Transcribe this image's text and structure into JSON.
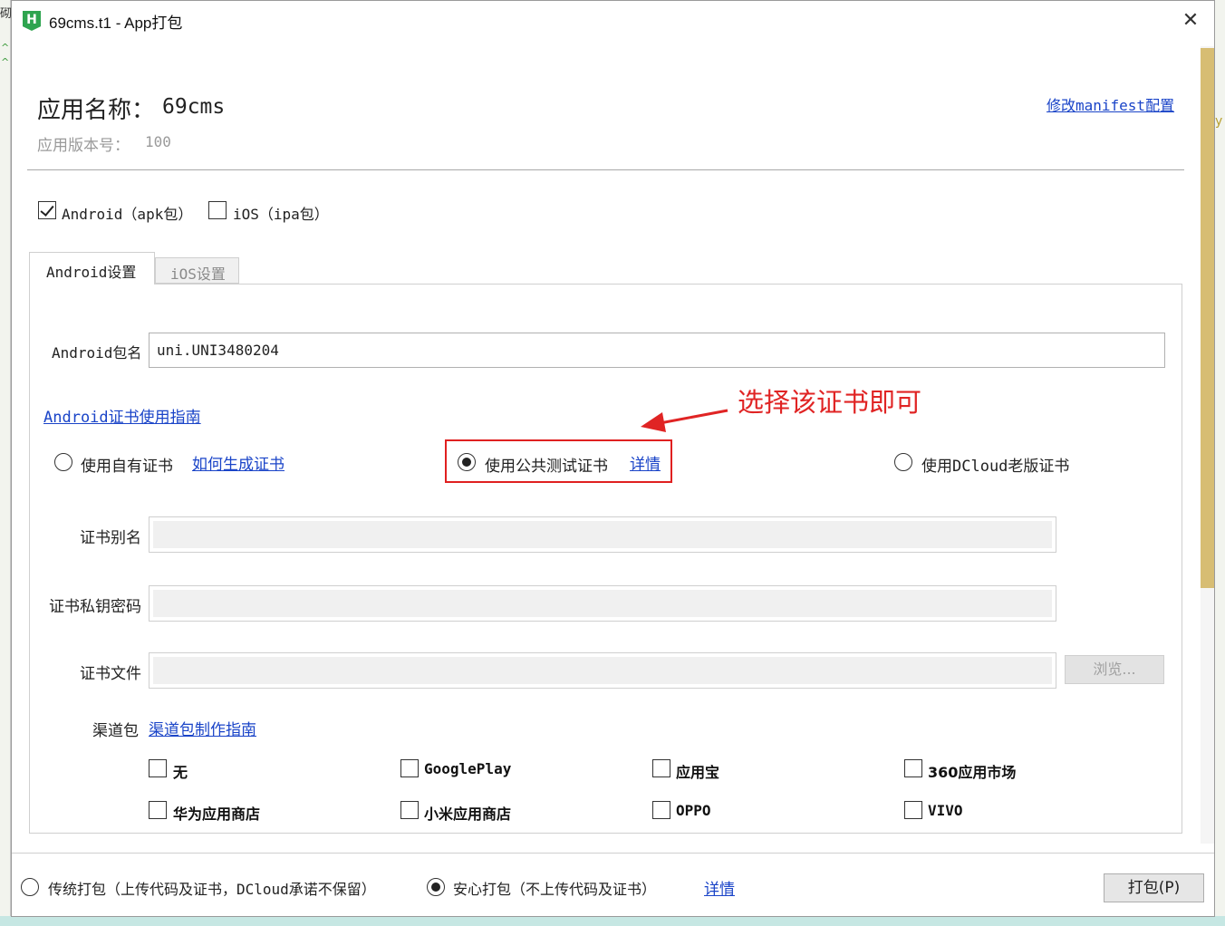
{
  "window": {
    "title": "69cms.t1 - App打包",
    "icon": "hbuilder-icon"
  },
  "app": {
    "name_label": "应用名称：",
    "name_value": "69cms",
    "version_label": "应用版本号：",
    "version_value": "100",
    "manifest_link": "修改manifest配置"
  },
  "platforms": [
    {
      "label": "Android（apk包）",
      "checked": true
    },
    {
      "label": "iOS（ipa包）",
      "checked": false
    }
  ],
  "tabs": [
    {
      "label": "Android设置",
      "active": true
    },
    {
      "label": "iOS设置",
      "active": false
    }
  ],
  "android": {
    "package_label": "Android包名",
    "package_value": "uni.UNI3480204",
    "cert_guide_link": "Android证书使用指南",
    "cert_options": [
      {
        "label": "使用自有证书",
        "link": "如何生成证书",
        "selected": false
      },
      {
        "label": "使用公共测试证书",
        "link": "详情",
        "selected": true
      },
      {
        "label": "使用DCloud老版证书",
        "selected": false
      }
    ],
    "cert_alias_label": "证书别名",
    "cert_password_label": "证书私钥密码",
    "cert_file_label": "证书文件",
    "browse_label": "浏览...",
    "channel_label": "渠道包",
    "channel_guide_link": "渠道包制作指南",
    "channels": [
      "无",
      "GooglePlay",
      "应用宝",
      "360应用市场",
      "华为应用商店",
      "小米应用商店",
      "OPPO",
      "VIVO"
    ]
  },
  "annotation": {
    "text": "选择该证书即可",
    "color": "#e02424"
  },
  "footer": {
    "options": [
      {
        "label": "传统打包（上传代码及证书，DCloud承诺不保留）",
        "selected": false
      },
      {
        "label": "安心打包（不上传代码及证书）",
        "selected": true
      }
    ],
    "details_link": "详情",
    "pack_button": "打包(P)"
  }
}
